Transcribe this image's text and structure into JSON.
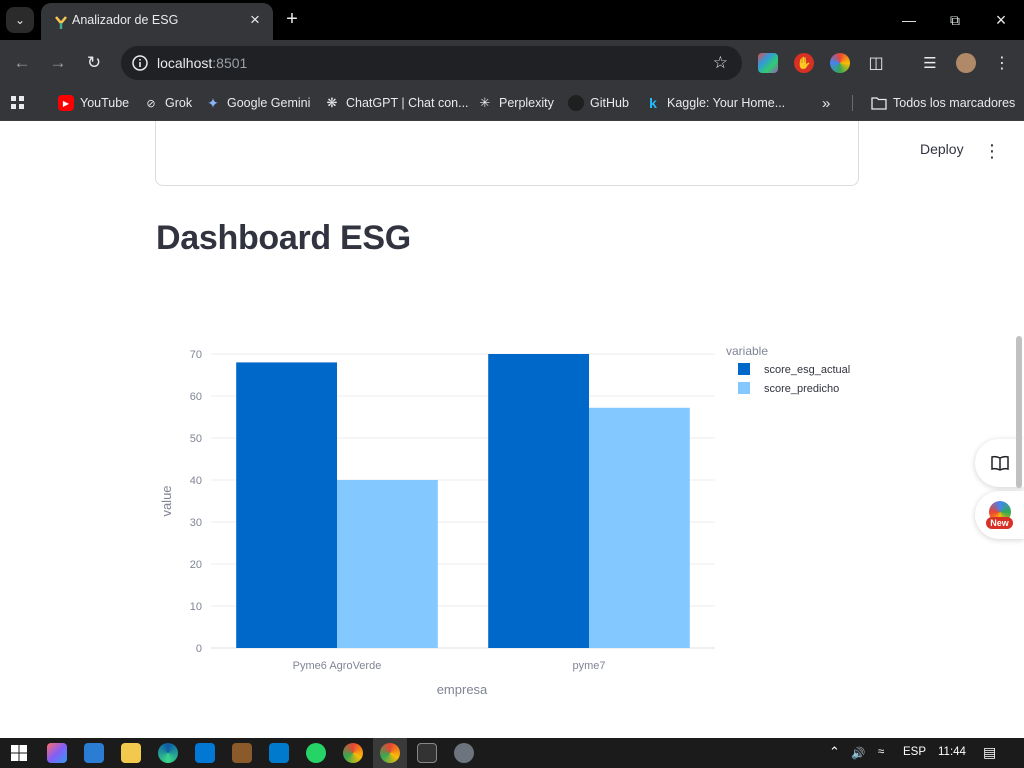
{
  "browser": {
    "tab_title": "Analizador de ESG",
    "url_host": "localhost",
    "url_port": ":8501",
    "bookmarks": [
      {
        "label": "YouTube",
        "icon": "youtube-icon"
      },
      {
        "label": "Grok",
        "icon": "grok-icon"
      },
      {
        "label": "Google Gemini",
        "icon": "gemini-icon"
      },
      {
        "label": "ChatGPT | Chat con...",
        "icon": "chatgpt-icon"
      },
      {
        "label": "Perplexity",
        "icon": "perplexity-icon"
      },
      {
        "label": "GitHub",
        "icon": "github-icon"
      },
      {
        "label": "Kaggle: Your Home...",
        "icon": "kaggle-icon"
      }
    ],
    "all_bookmarks_label": "Todos los marcadores"
  },
  "app": {
    "deploy_label": "Deploy",
    "title": "Dashboard ESG",
    "new_badge": "New"
  },
  "chart_data": {
    "type": "bar",
    "categories": [
      "Pyme6 AgroVerde",
      "pyme7"
    ],
    "series": [
      {
        "name": "score_esg_actual",
        "values": [
          68,
          70
        ],
        "color": "#0068c9"
      },
      {
        "name": "score_predicho",
        "values": [
          40,
          57.2
        ],
        "color": "#83c9ff"
      }
    ],
    "xlabel": "empresa",
    "ylabel": "value",
    "legend_title": "variable",
    "ylim": [
      0,
      70
    ],
    "yticks": [
      0,
      10,
      20,
      30,
      40,
      50,
      60,
      70
    ],
    "grid": true,
    "legend_position": "top-right"
  },
  "taskbar": {
    "language": "ESP",
    "time": "11:44"
  }
}
